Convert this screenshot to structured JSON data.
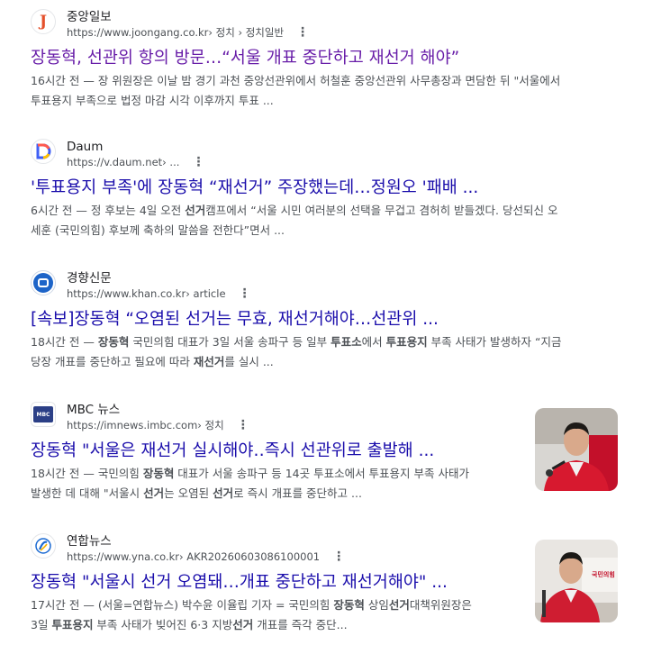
{
  "results": [
    {
      "site_name": "중앙일보",
      "url": "https://www.joongang.co.kr",
      "breadcrumb": " › 정치 › 정치일반",
      "title": "장동혁, 선관위 항의 방문…“서울 개표 중단하고 재선거 해야”",
      "snippet_line1": "16시간 전 — 장 위원장은 이날 밤 경기 과천 중앙선관위에서 허철훈 중앙선관위 사무총장과 면담한 뒤 \"서울에서",
      "snippet_line2": "투표용지 부족으로 법정 마감 시각 이후까지 투표 ..."
    },
    {
      "site_name": "Daum",
      "url": "https://v.daum.net",
      "breadcrumb": " › ...",
      "title": "'투표용지 부족'에 장동혁 “재선거” 주장했는데…정원오 '패배 ...",
      "snippet_line1_a": "6시간 전 — 정 후보는 4일 오전 ",
      "snippet_line1_b": "선거",
      "snippet_line1_c": "캠프에서 “서울 시민 여러분의 선택을 무겁고 겸허히 받들겠다. 당선되신 오",
      "snippet_line2": "세훈 (국민의힘) 후보께 축하의 말씀을 전한다”면서 ..."
    },
    {
      "site_name": "경향신문",
      "url": "https://www.khan.co.kr",
      "breadcrumb": " › article",
      "title": "[속보]장동혁 “오염된 선거는 무효, 재선거해야…선관위 ...",
      "snippet_line1_a": "18시간 전 — ",
      "snippet_line1_b": "장동혁",
      "snippet_line1_c": " 국민의힘 대표가 3일 서울 송파구 등 일부 ",
      "snippet_line1_d": "투표소",
      "snippet_line1_e": "에서 ",
      "snippet_line1_f": "투표용지",
      "snippet_line1_g": " 부족 사태가 발생하자 “지금",
      "snippet_line2_a": "당장 개표를 중단하고 필요에 따라 ",
      "snippet_line2_b": "재선거",
      "snippet_line2_c": "를 실시 ..."
    },
    {
      "site_name": "MBC 뉴스",
      "url": "https://imnews.imbc.com",
      "breadcrumb": " › 정치",
      "title": "장동혁 \"서울은 재선거 실시해야‥즉시 선관위로 출발해 ...",
      "snippet_line1_a": "18시간 전 — 국민의힘 ",
      "snippet_line1_b": "장동혁",
      "snippet_line1_c": " 대표가 서울 송파구 등 14곳 투표소에서 투표용지 부족 사태가",
      "snippet_line2_a": "발생한 데 대해 \"서울시 ",
      "snippet_line2_b": "선거",
      "snippet_line2_c": "는 오염된 ",
      "snippet_line2_d": "선거",
      "snippet_line2_e": "로 즉시 개표를 중단하고 ..."
    },
    {
      "site_name": "연합뉴스",
      "url": "https://www.yna.co.kr",
      "breadcrumb": " › AKR20260603086100001",
      "title": "장동혁 \"서울시 선거 오염돼…개표 중단하고 재선거해야\" ...",
      "snippet_line1_a": "17시간 전 — (서울=연합뉴스) 박수윤 이율립 기자 = 국민의힘 ",
      "snippet_line1_b": "장동혁",
      "snippet_line1_c": " 상임",
      "snippet_line1_d": "선거",
      "snippet_line1_e": "대책위원장은",
      "snippet_line2_a": "3일 ",
      "snippet_line2_b": "투표용지",
      "snippet_line2_c": " 부족 사태가 빚어진 6·3 지방",
      "snippet_line2_d": "선거",
      "snippet_line2_e": " 개표를 즉각 중단..."
    }
  ],
  "icons": {
    "joongang_letter": "J",
    "mbc_logo_text": "MBC",
    "photo_sign_text": "국민의힘"
  },
  "colors": {
    "link": "#1a0dab",
    "visited": "#681da8",
    "snippet": "#4d5156"
  }
}
